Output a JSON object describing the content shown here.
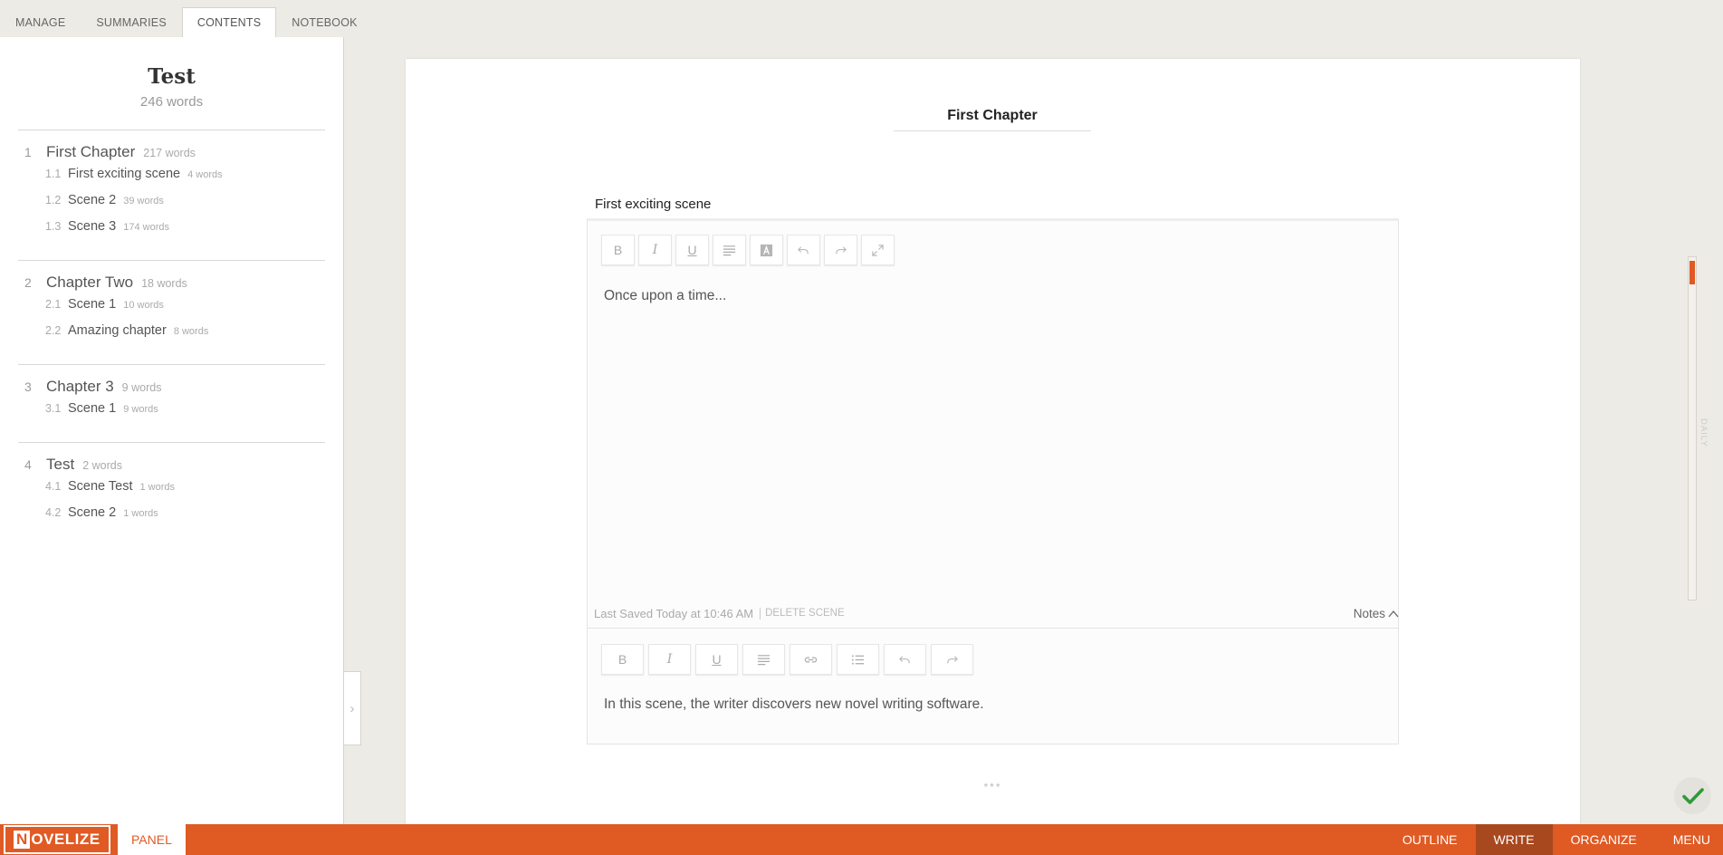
{
  "tabs": [
    "MANAGE",
    "SUMMARIES",
    "CONTENTS",
    "NOTEBOOK"
  ],
  "active_tab": "CONTENTS",
  "book": {
    "title": "Test",
    "words": "246 words"
  },
  "chapters": [
    {
      "num": "1",
      "title": "First Chapter",
      "words": "217 words",
      "scenes": [
        {
          "num": "1.1",
          "title": "First exciting scene",
          "words": "4 words"
        },
        {
          "num": "1.2",
          "title": "Scene 2",
          "words": "39 words"
        },
        {
          "num": "1.3",
          "title": "Scene 3",
          "words": "174 words"
        }
      ]
    },
    {
      "num": "2",
      "title": "Chapter Two",
      "words": "18 words",
      "scenes": [
        {
          "num": "2.1",
          "title": "Scene 1",
          "words": "10 words"
        },
        {
          "num": "2.2",
          "title": "Amazing chapter",
          "words": "8 words"
        }
      ]
    },
    {
      "num": "3",
      "title": "Chapter 3",
      "words": "9 words",
      "scenes": [
        {
          "num": "3.1",
          "title": "Scene 1",
          "words": "9 words"
        }
      ]
    },
    {
      "num": "4",
      "title": "Test",
      "words": "2 words",
      "scenes": [
        {
          "num": "4.1",
          "title": "Scene Test",
          "words": "1 words"
        },
        {
          "num": "4.2",
          "title": "Scene 2",
          "words": "1 words"
        }
      ]
    }
  ],
  "editor": {
    "chapter_title": "First Chapter",
    "scene_title": "First exciting scene",
    "content": "Once upon a time...",
    "toolbar_labels": {
      "bold": "B",
      "italic": "I",
      "underline": "U"
    },
    "last_saved": "Last Saved Today at 10:46 AM",
    "delete_scene": "DELETE SCENE",
    "notes_label": "Notes",
    "notes_text": "In this scene, the writer discovers new novel writing software.",
    "separator": "***"
  },
  "goal": {
    "label": "DAILY",
    "progress": 0.07
  },
  "bottombar": {
    "logo": "NOVELIZE",
    "panel_label": "PANEL",
    "nav": [
      "OUTLINE",
      "WRITE",
      "ORGANIZE",
      "MENU"
    ],
    "active_nav": "WRITE"
  },
  "colors": {
    "accent": "#e05a24",
    "active_nav": "#a8481e",
    "check": "#2e9a3a"
  }
}
